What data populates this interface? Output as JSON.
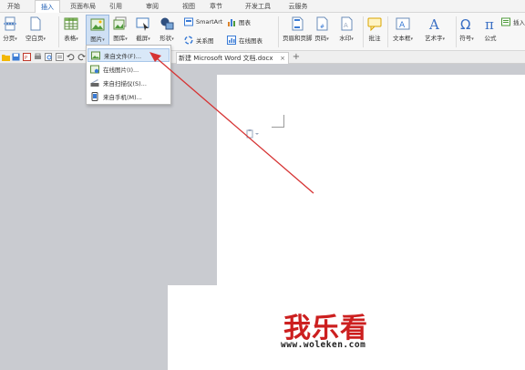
{
  "menu_tabs": [
    "开始",
    "插入",
    "页面布局",
    "引用",
    "审阅",
    "视图",
    "章节",
    "开发工具",
    "云服务"
  ],
  "active_tab": "插入",
  "ribbon": {
    "page_break": "分页",
    "blank_page": "空白页",
    "table": "表格",
    "picture": "图片",
    "gallery": "图库",
    "screenshot": "截屏",
    "shapes": "形状",
    "smartart": "SmartArt",
    "chart": "图表",
    "relation": "关系图",
    "online_chart": "在线图表",
    "header_footer": "页眉和页脚",
    "page_number": "页码",
    "watermark": "水印",
    "comment": "批注",
    "textbox": "文本框",
    "wordart": "艺术字",
    "symbol": "符号",
    "formula": "公式",
    "insert_more": "插入"
  },
  "picture_menu": [
    {
      "label": "来自文件(F)..."
    },
    {
      "label": "在线图片(I)..."
    },
    {
      "label": "来自扫描仪(S)..."
    },
    {
      "label": "来自手机(M)..."
    }
  ],
  "document_tab": "新建 Microsoft Word 文档.docx",
  "watermark": {
    "title": "我乐看",
    "url": "www.woleken.com"
  },
  "colors": {
    "accent": "#1f5fb5",
    "arrow": "#d63333",
    "watermark_title": "#cc1f1f"
  }
}
